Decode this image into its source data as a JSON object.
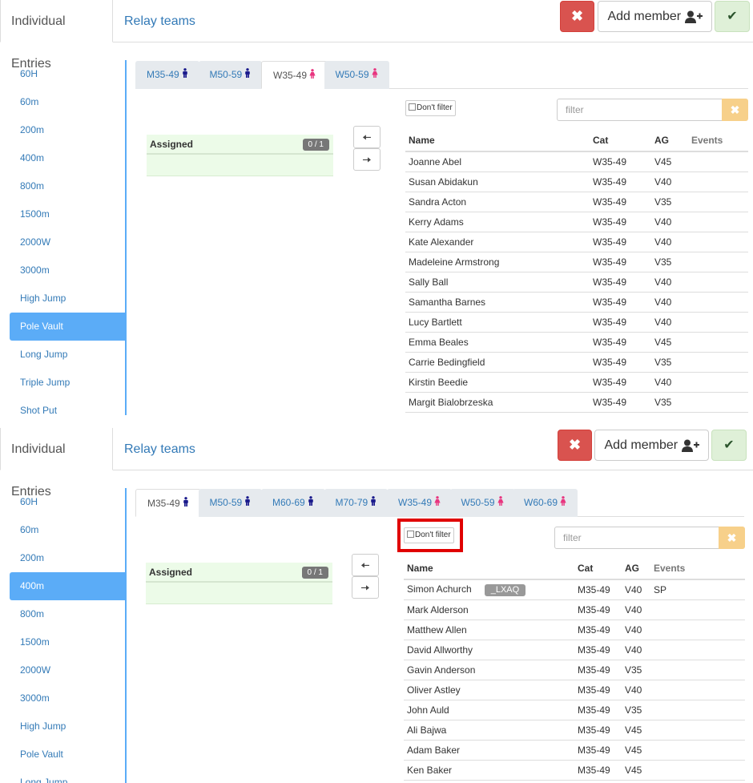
{
  "panel1": {
    "top_tabs": [
      "Individual Entries",
      "Relay teams"
    ],
    "buttons": {
      "close": "✖",
      "add_member": "Add member",
      "confirm": "✔"
    },
    "side_items": [
      "60H",
      "60m",
      "200m",
      "400m",
      "800m",
      "1500m",
      "2000W",
      "3000m",
      "High Jump",
      "Pole Vault",
      "Long Jump",
      "Triple Jump",
      "Shot Put"
    ],
    "active_side": "Pole Vault",
    "category_tabs": [
      {
        "label": "M35-49",
        "gender": "m"
      },
      {
        "label": "M50-59",
        "gender": "m"
      },
      {
        "label": "W35-49",
        "gender": "f"
      },
      {
        "label": "W50-59",
        "gender": "f"
      }
    ],
    "active_category": "W35-49",
    "assigned": {
      "label": "Assigned",
      "count": "0 / 1"
    },
    "dont_filter": "Don't filter",
    "filter_placeholder": "filter",
    "columns": [
      "Name",
      "Cat",
      "AG",
      "Events"
    ],
    "rows": [
      {
        "name": "Joanne Abel",
        "cat": "W35-49",
        "ag": "V45",
        "events": ""
      },
      {
        "name": "Susan Abidakun",
        "cat": "W35-49",
        "ag": "V40",
        "events": ""
      },
      {
        "name": "Sandra Acton",
        "cat": "W35-49",
        "ag": "V35",
        "events": ""
      },
      {
        "name": "Kerry Adams",
        "cat": "W35-49",
        "ag": "V40",
        "events": ""
      },
      {
        "name": "Kate Alexander",
        "cat": "W35-49",
        "ag": "V40",
        "events": ""
      },
      {
        "name": "Madeleine Armstrong",
        "cat": "W35-49",
        "ag": "V35",
        "events": ""
      },
      {
        "name": "Sally Ball",
        "cat": "W35-49",
        "ag": "V40",
        "events": ""
      },
      {
        "name": "Samantha Barnes",
        "cat": "W35-49",
        "ag": "V40",
        "events": ""
      },
      {
        "name": "Lucy Bartlett",
        "cat": "W35-49",
        "ag": "V40",
        "events": ""
      },
      {
        "name": "Emma Beales",
        "cat": "W35-49",
        "ag": "V45",
        "events": ""
      },
      {
        "name": "Carrie Bedingfield",
        "cat": "W35-49",
        "ag": "V35",
        "events": ""
      },
      {
        "name": "Kirstin Beedie",
        "cat": "W35-49",
        "ag": "V40",
        "events": ""
      },
      {
        "name": "Margit Bialobrzeska",
        "cat": "W35-49",
        "ag": "V35",
        "events": ""
      }
    ]
  },
  "panel2": {
    "top_tabs": [
      "Individual Entries",
      "Relay teams"
    ],
    "buttons": {
      "close": "✖",
      "add_member": "Add member",
      "confirm": "✔"
    },
    "side_items": [
      "60H",
      "60m",
      "200m",
      "400m",
      "800m",
      "1500m",
      "2000W",
      "3000m",
      "High Jump",
      "Pole Vault",
      "Long Jump"
    ],
    "active_side": "400m",
    "category_tabs": [
      {
        "label": "M35-49",
        "gender": "m"
      },
      {
        "label": "M50-59",
        "gender": "m"
      },
      {
        "label": "M60-69",
        "gender": "m"
      },
      {
        "label": "M70-79",
        "gender": "m"
      },
      {
        "label": "W35-49",
        "gender": "f"
      },
      {
        "label": "W50-59",
        "gender": "f"
      },
      {
        "label": "W60-69",
        "gender": "f"
      }
    ],
    "active_category": "M35-49",
    "assigned": {
      "label": "Assigned",
      "count": "0 / 1"
    },
    "dont_filter": "Don't filter",
    "filter_placeholder": "filter",
    "columns": [
      "Name",
      "Cat",
      "AG",
      "Events"
    ],
    "rows": [
      {
        "name": "Simon Achurch",
        "badge": "_LXAQ",
        "cat": "M35-49",
        "ag": "V40",
        "events": "SP"
      },
      {
        "name": "Mark Alderson",
        "cat": "M35-49",
        "ag": "V40",
        "events": ""
      },
      {
        "name": "Matthew Allen",
        "cat": "M35-49",
        "ag": "V40",
        "events": ""
      },
      {
        "name": "David Allworthy",
        "cat": "M35-49",
        "ag": "V40",
        "events": ""
      },
      {
        "name": "Gavin Anderson",
        "cat": "M35-49",
        "ag": "V35",
        "events": ""
      },
      {
        "name": "Oliver Astley",
        "cat": "M35-49",
        "ag": "V40",
        "events": ""
      },
      {
        "name": "John Auld",
        "cat": "M35-49",
        "ag": "V35",
        "events": ""
      },
      {
        "name": "Ali Bajwa",
        "cat": "M35-49",
        "ag": "V45",
        "events": ""
      },
      {
        "name": "Adam Baker",
        "cat": "M35-49",
        "ag": "V45",
        "events": ""
      },
      {
        "name": "Ken Baker",
        "cat": "M35-49",
        "ag": "V45",
        "events": ""
      }
    ]
  },
  "colors": {
    "accent": "#337ab7",
    "active_side": "#5bacf7",
    "danger": "#d9534f",
    "success_bg": "#dff0d8",
    "warning": "#f7d08a",
    "male_icon": "#1a1a8c",
    "female_icon": "#e8357f",
    "highlight_box": "#e00000"
  }
}
